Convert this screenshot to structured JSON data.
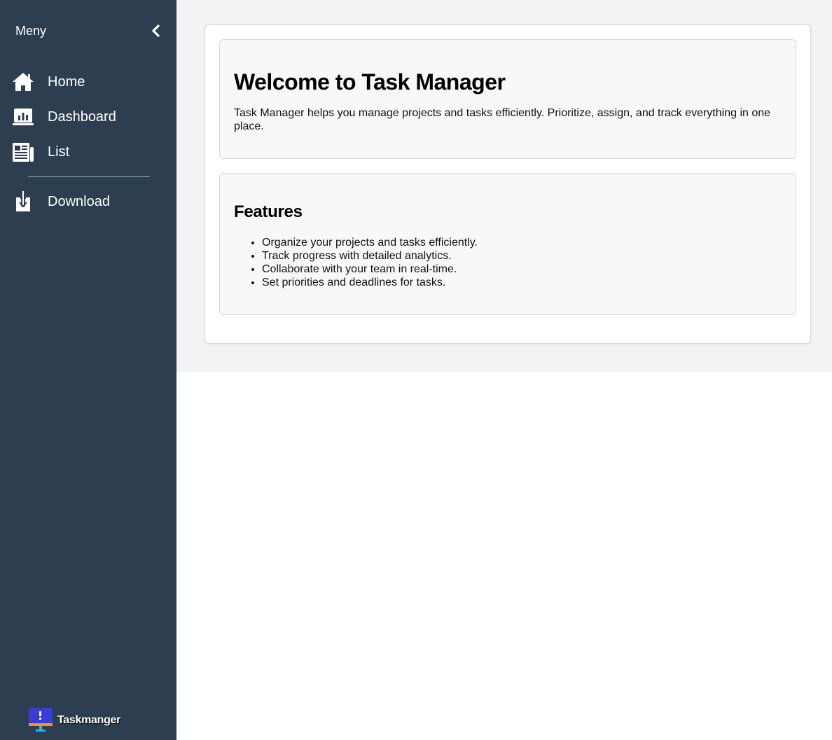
{
  "sidebar": {
    "title": "Meny",
    "collapse_icon": "chevron-left-icon",
    "items": [
      {
        "label": "Home",
        "icon": "home-icon"
      },
      {
        "label": "Dashboard",
        "icon": "dashboard-icon"
      },
      {
        "label": "List",
        "icon": "list-icon"
      },
      {
        "label": "Download",
        "icon": "download-icon"
      }
    ],
    "brand": {
      "name": "Taskmanger",
      "icon": "monitor-logo-icon"
    }
  },
  "main": {
    "welcome": {
      "title": "Welcome to Task Manager",
      "text": "Task Manager helps you manage projects and tasks efficiently. Prioritize, assign, and track everything in one place."
    },
    "features": {
      "title": "Features",
      "items": [
        "Organize your projects and tasks efficiently.",
        "Track progress with detailed analytics.",
        "Collaborate with your team in real-time.",
        "Set priorities and deadlines for tasks."
      ]
    }
  },
  "colors": {
    "sidebar_bg": "#2d3e50",
    "main_bg": "#f3f3f3",
    "card_bg": "#f8f8f8",
    "logo_blue": "#3b3bd8",
    "logo_orange": "#f7941d",
    "logo_cyan": "#2bb3e8"
  }
}
